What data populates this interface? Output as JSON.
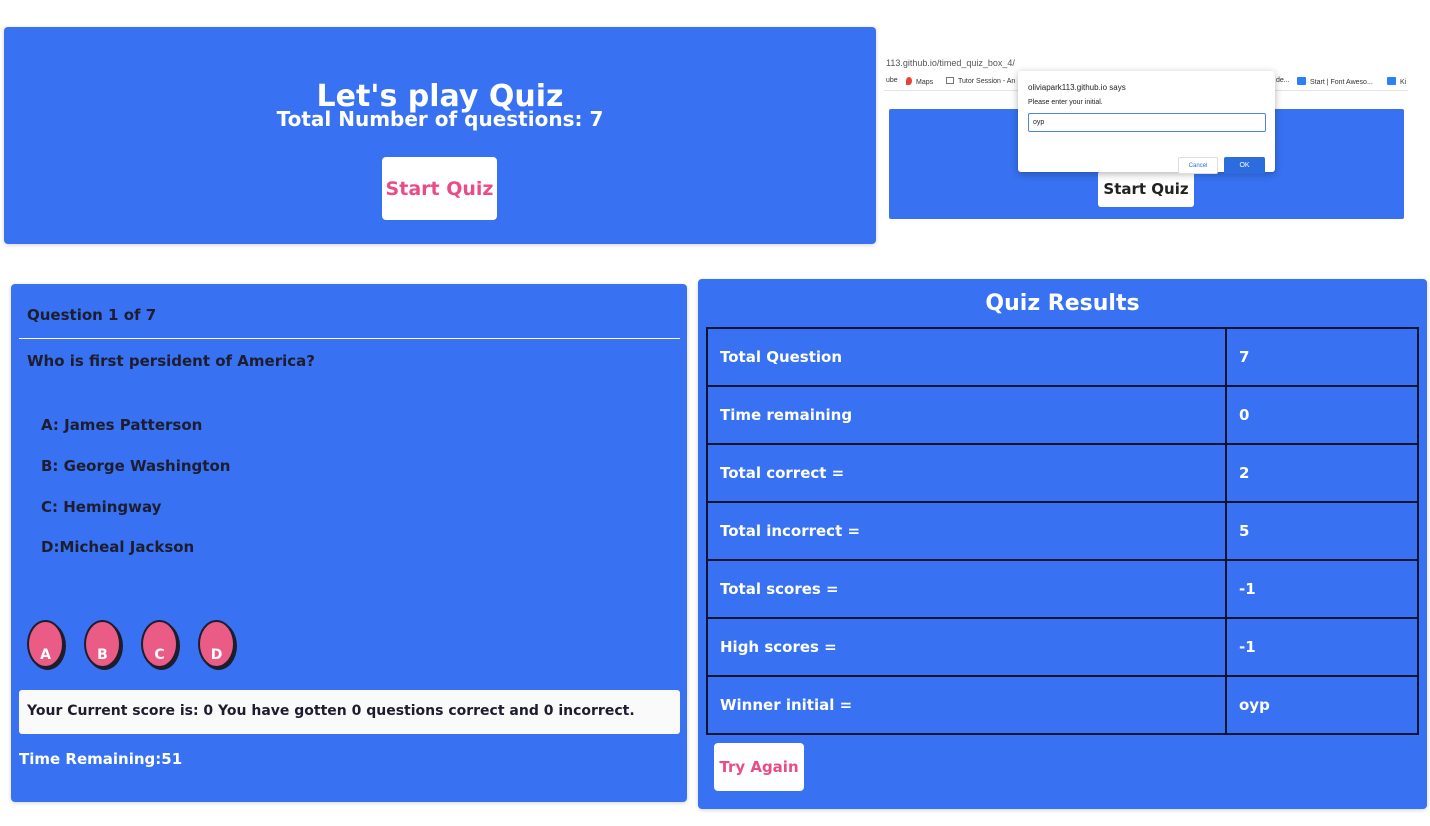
{
  "start_panel": {
    "title": "Let's play Quiz",
    "subtitle": "Total Number of questions: 7",
    "start_button": "Start Quiz"
  },
  "prompt_screenshot": {
    "url": "113.github.io/timed_quiz_box_4/",
    "bookmarks": [
      "ube",
      "Maps",
      "Tutor Session - An",
      "de...",
      "Start | Font Aweso...",
      "Ki"
    ],
    "dialog": {
      "title": "oliviapark113.github.io says",
      "message": "Please enter your initial.",
      "input_value": "oyp",
      "cancel_label": "Cancel",
      "ok_label": "OK"
    },
    "start_button": "Start Quiz"
  },
  "question_panel": {
    "header": "Question 1 of 7",
    "question": "Who is first persident of America?",
    "options": [
      "A: James Patterson",
      "B: George Washington",
      "C: Hemingway",
      "D:Micheal Jackson"
    ],
    "answer_buttons": [
      "A",
      "B",
      "C",
      "D"
    ],
    "score_text": "Your Current score is: 0 You have gotten 0 questions correct and 0 incorrect.",
    "time_remaining": "Time Remaining:51"
  },
  "results_panel": {
    "title": "Quiz Results",
    "rows": [
      {
        "label": "Total Question",
        "value": "7"
      },
      {
        "label": "Time remaining",
        "value": "0"
      },
      {
        "label": "Total correct =",
        "value": "2"
      },
      {
        "label": "Total incorrect =",
        "value": "5"
      },
      {
        "label": "Total scores =",
        "value": "-1"
      },
      {
        "label": "High scores =",
        "value": "-1"
      },
      {
        "label": "Winner initial =",
        "value": "oyp"
      }
    ],
    "try_again": "Try Again"
  },
  "colors": {
    "panel_blue": "#3872f2",
    "accent_pink": "#ea4c89",
    "dark_text": "#1d1d2e"
  }
}
